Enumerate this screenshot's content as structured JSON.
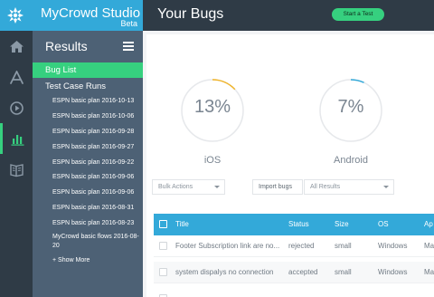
{
  "brand": {
    "title": "MyCrowd Studio",
    "subtitle": "Beta"
  },
  "header": {
    "title": "Your Bugs",
    "start_test_label": "Start a Test"
  },
  "rail": {
    "items": [
      "home-icon",
      "apps-icon",
      "play-icon",
      "bar-chart-icon",
      "book-icon"
    ],
    "active_index": 3
  },
  "panel": {
    "title": "Results",
    "bug_list_label": "Bug List",
    "test_case_runs_label": "Test Case Runs",
    "runs": [
      "ESPN basic plan 2016-10-13",
      "ESPN basic plan 2016-10-06",
      "ESPN basic plan 2016-09-28",
      "ESPN basic plan 2016-09-27",
      "ESPN basic plan 2016-09-22",
      "ESPN basic plan 2016-09-06",
      "ESPN basic plan 2016-09-06",
      "ESPN basic plan 2016-08-31",
      "ESPN basic plan 2016-08-23",
      "MyCrowd basic flows 2016-08-20"
    ],
    "show_more_label": "+ Show More"
  },
  "stats": [
    {
      "value": "13%",
      "label": "iOS",
      "fraction": 0.13,
      "color": "#f0b429"
    },
    {
      "value": "7%",
      "label": "Android",
      "fraction": 0.07,
      "color": "#33a9d9"
    }
  ],
  "controls": {
    "bulk_actions": "Bulk Actions",
    "import_bugs": "Import bugs",
    "filter": "All Results"
  },
  "table": {
    "columns": [
      "Title",
      "Status",
      "Size",
      "OS",
      "Ap"
    ],
    "rows": [
      {
        "title": "Footer Subscription link are no...",
        "status": "rejected",
        "size": "small",
        "os": "Windows",
        "app": "Ma"
      },
      {
        "title": "system dispalys no connection",
        "status": "accepted",
        "size": "small",
        "os": "Windows",
        "app": "Ma"
      },
      {
        "title": "",
        "status": "",
        "size": "",
        "os": "",
        "app": ""
      }
    ]
  },
  "colors": {
    "accent": "#33a9d9",
    "active": "#36d07f",
    "sidebar": "#2f3b46",
    "panel": "#4d6175"
  }
}
